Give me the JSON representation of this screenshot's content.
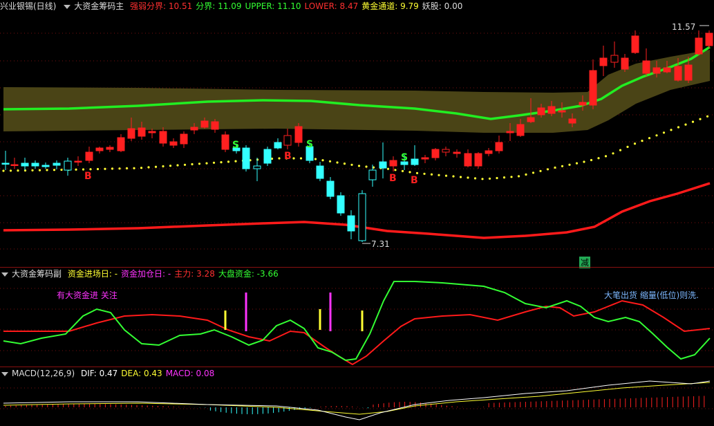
{
  "main": {
    "stock": "兴业银锡(日线)",
    "indicator": "大资金筹码主",
    "items": [
      {
        "label": "强弱分界:",
        "value": "10.51",
        "color": "#ff3030"
      },
      {
        "label": "分界:",
        "value": "11.09",
        "color": "#33ff33"
      },
      {
        "label": "UPPER:",
        "value": "11.10",
        "color": "#33ff33"
      },
      {
        "label": "LOWER:",
        "value": "8.47",
        "color": "#ff3030"
      },
      {
        "label": "黄金通道:",
        "value": "9.79",
        "color": "#ffff33"
      },
      {
        "label": "妖股:",
        "value": "0.00",
        "color": "#dddddd"
      }
    ],
    "high_label": "11.57",
    "low_label": "7.31",
    "jian_label": "减",
    "buy_label": "B",
    "sell_label": "S"
  },
  "sub": {
    "indicator": "大资金筹码副",
    "items": [
      {
        "label": "资金进场日:",
        "value": "-",
        "color": "#ffff33"
      },
      {
        "label": "资金加仓日:",
        "value": "-",
        "color": "#ff33ff"
      },
      {
        "label": "主力:",
        "value": "3.28",
        "color": "#ff3030"
      },
      {
        "label": "大盘资金:",
        "value": "-3.66",
        "color": "#33ff33"
      }
    ],
    "ann_left": "有大资金进 关注",
    "ann_right": "大笔出货 缩量(低位)则洗."
  },
  "macd": {
    "indicator": "MACD(12,26,9)",
    "items": [
      {
        "label": "DIF:",
        "value": "0.47",
        "color": "#ffffff"
      },
      {
        "label": "DEA:",
        "value": "0.43",
        "color": "#ffff33"
      },
      {
        "label": "MACD:",
        "value": "0.08",
        "color": "#ff33ff"
      }
    ]
  },
  "colors": {
    "up": "#ff2020",
    "down": "#33ffff",
    "green": "#33ff33",
    "band": "#4a4416",
    "dots": "#ffff33"
  }
}
